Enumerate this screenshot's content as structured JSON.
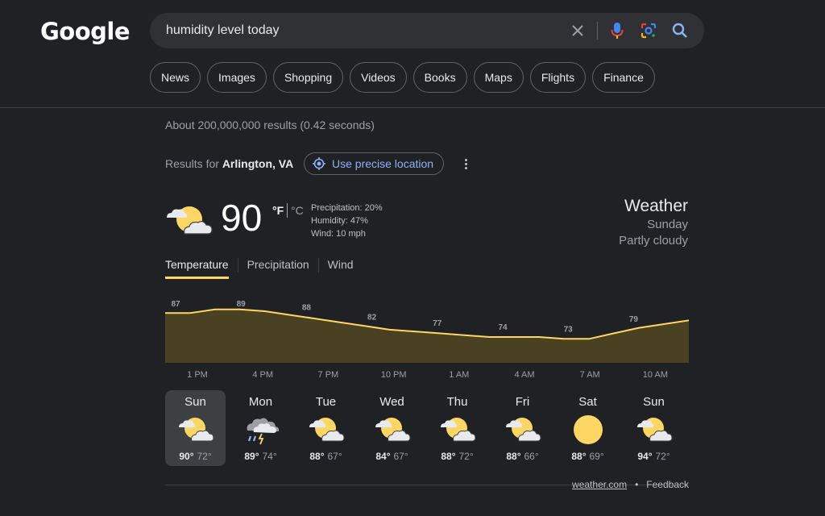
{
  "logo": "Google",
  "search": {
    "query": "humidity level today"
  },
  "chips": [
    "News",
    "Images",
    "Shopping",
    "Videos",
    "Books",
    "Maps",
    "Flights",
    "Finance"
  ],
  "stats": "About 200,000,000 results (0.42 seconds)",
  "location": {
    "prefix": "Results for",
    "place": "Arlington, VA",
    "precise_button": "Use precise location"
  },
  "current": {
    "temp": "90",
    "unit_f": "°F",
    "unit_c": "°C",
    "precipitation": "Precipitation: 20%",
    "humidity": "Humidity: 47%",
    "wind": "Wind: 10 mph",
    "icon": "partly-cloudy-icon"
  },
  "header": {
    "title": "Weather",
    "day": "Sunday",
    "condition": "Partly cloudy"
  },
  "tabs": [
    "Temperature",
    "Precipitation",
    "Wind"
  ],
  "chart_data": {
    "type": "area",
    "x": [
      "1 PM",
      "4 PM",
      "7 PM",
      "10 PM",
      "1 AM",
      "4 AM",
      "7 AM",
      "10 AM"
    ],
    "labels": [
      "87",
      "89",
      "88",
      "82",
      "77",
      "74",
      "73",
      "79"
    ],
    "series": [
      {
        "values": [
          87,
          87,
          89,
          89,
          88,
          86,
          84,
          82,
          80,
          78,
          77,
          76,
          75,
          74,
          74,
          74,
          73,
          73,
          76,
          79,
          81,
          83
        ]
      }
    ],
    "ylim": [
      60,
      95
    ],
    "line_color": "#fdd663",
    "fill_color": "#4a4122"
  },
  "forecast": [
    {
      "day": "Sun",
      "high": "90°",
      "low": "72°",
      "icon": "partly-cloudy-icon"
    },
    {
      "day": "Mon",
      "high": "89°",
      "low": "74°",
      "icon": "thunderstorm-icon"
    },
    {
      "day": "Tue",
      "high": "88°",
      "low": "67°",
      "icon": "partly-cloudy-icon"
    },
    {
      "day": "Wed",
      "high": "84°",
      "low": "67°",
      "icon": "partly-cloudy-icon"
    },
    {
      "day": "Thu",
      "high": "88°",
      "low": "72°",
      "icon": "partly-cloudy-icon"
    },
    {
      "day": "Fri",
      "high": "88°",
      "low": "66°",
      "icon": "partly-cloudy-icon"
    },
    {
      "day": "Sat",
      "high": "88°",
      "low": "69°",
      "icon": "sunny-icon"
    },
    {
      "day": "Sun",
      "high": "94°",
      "low": "72°",
      "icon": "partly-cloudy-icon"
    }
  ],
  "footer": {
    "source": "weather.com",
    "sep": "•",
    "feedback": "Feedback"
  },
  "colors": {
    "background": "#202124",
    "accent_yellow": "#fdd663",
    "link_blue": "#8ab4f8"
  }
}
